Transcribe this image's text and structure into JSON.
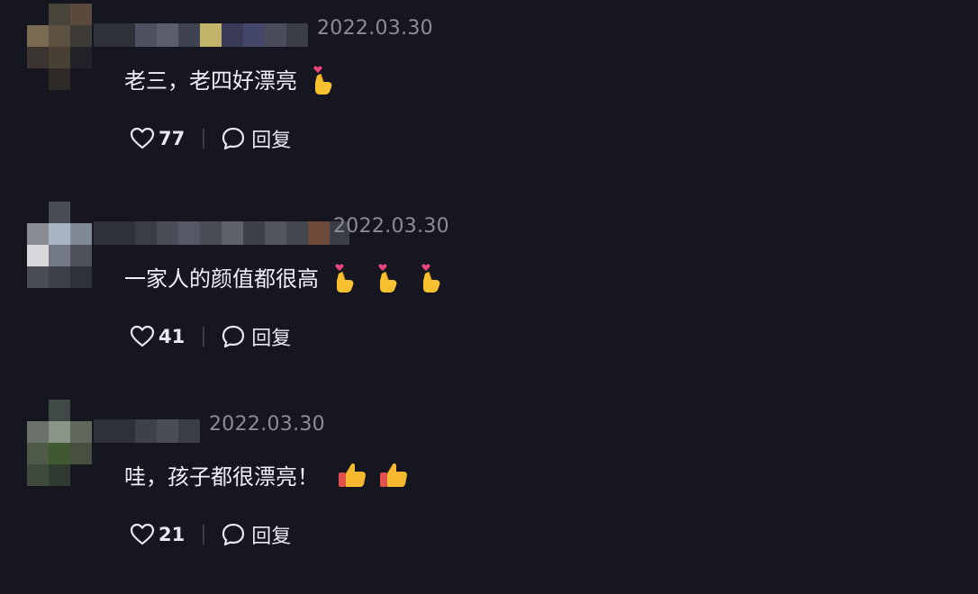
{
  "comments": [
    {
      "date": "2022.03.30",
      "text": "老三，老四好漂亮",
      "emojis": [
        "finger-heart-icon"
      ],
      "likes": "77",
      "reply_label": "回复"
    },
    {
      "date": "2022.03.30",
      "text": "一家人的颜值都很高",
      "emojis": [
        "finger-heart-icon",
        "finger-heart-icon",
        "finger-heart-icon"
      ],
      "likes": "41",
      "reply_label": "回复"
    },
    {
      "date": "2022.03.30",
      "text": "哇，孩子都很漂亮！",
      "emojis": [
        "thumbs-up-icon",
        "thumbs-up-icon"
      ],
      "likes": "21",
      "reply_label": "回复"
    }
  ],
  "colors": {
    "background": "#15161f",
    "date": "#8a8c98",
    "text": "#eef0f5",
    "finger_heart": "#f7c12f",
    "heart_pink": "#e8457a",
    "thumb": "#f5b82e",
    "thumb_cuff": "#e2504d"
  }
}
